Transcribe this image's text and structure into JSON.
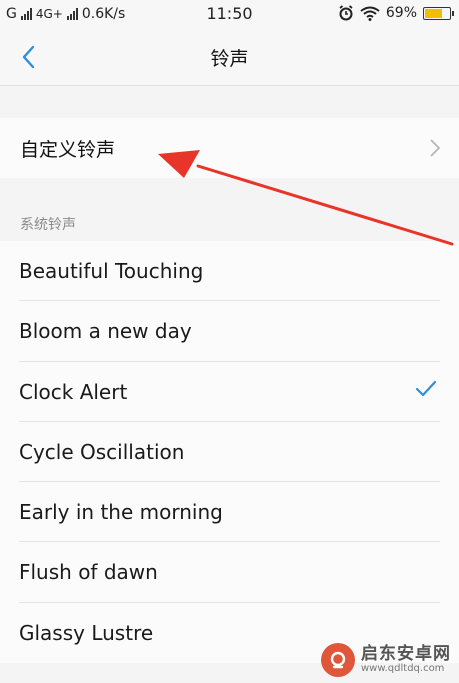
{
  "status_bar": {
    "carrier_1": "G",
    "carrier_2": "4G+",
    "net_speed": "0.6K/s",
    "time": "11:50",
    "battery_percent": "69%",
    "battery_level": 0.69,
    "battery_color": "#f0c000"
  },
  "header": {
    "title": "铃声",
    "back_icon": "chevron-left-icon",
    "accent": "#2d8fe0"
  },
  "custom_ringtone": {
    "label": "自定义铃声",
    "chevron_icon": "chevron-right-icon"
  },
  "system_section": {
    "title": "系统铃声",
    "items": [
      {
        "name": "Beautiful Touching",
        "selected": false
      },
      {
        "name": "Bloom a new day",
        "selected": false
      },
      {
        "name": "Clock Alert",
        "selected": true
      },
      {
        "name": "Cycle Oscillation",
        "selected": false
      },
      {
        "name": "Early in the morning",
        "selected": false
      },
      {
        "name": "Flush of dawn",
        "selected": false
      },
      {
        "name": "Glassy Lustre",
        "selected": false
      }
    ]
  },
  "annotation": {
    "arrow_color": "#e8352a"
  },
  "watermark": {
    "name": "启东安卓网",
    "url": "www.qdltdq.com"
  }
}
